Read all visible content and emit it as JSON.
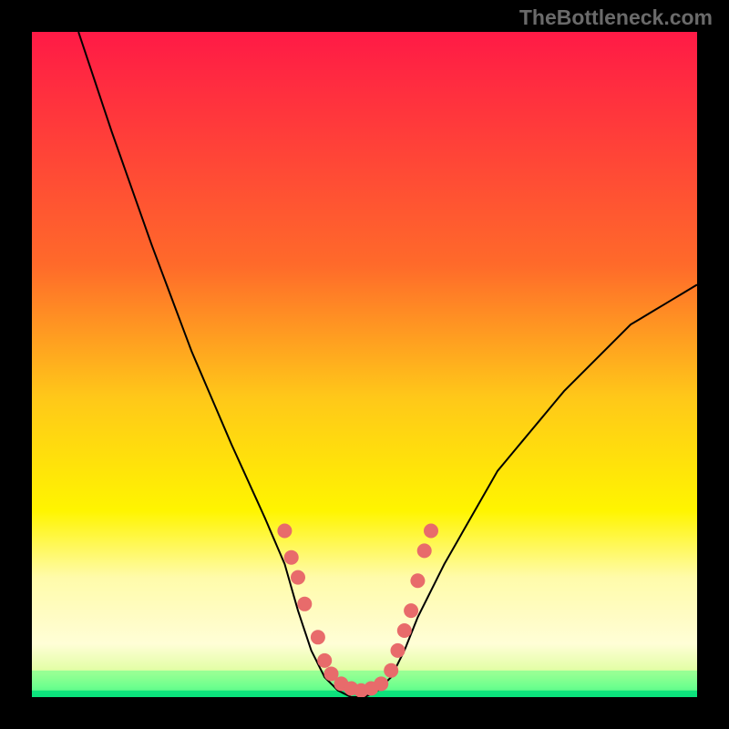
{
  "watermark": "TheBottleneck.com",
  "chart_data": {
    "type": "line",
    "title": "",
    "xlabel": "",
    "ylabel": "",
    "xlim": [
      0,
      100
    ],
    "ylim": [
      0,
      100
    ],
    "background": {
      "type": "vertical-gradient",
      "stops": [
        {
          "offset": 0.0,
          "color": "#ff1a46"
        },
        {
          "offset": 0.35,
          "color": "#ff6a2a"
        },
        {
          "offset": 0.55,
          "color": "#ffc819"
        },
        {
          "offset": 0.72,
          "color": "#fff500"
        },
        {
          "offset": 0.82,
          "color": "#fffbaa"
        },
        {
          "offset": 0.92,
          "color": "#ffffe5"
        },
        {
          "offset": 0.965,
          "color": "#d4ff9a"
        },
        {
          "offset": 0.985,
          "color": "#5aff8a"
        },
        {
          "offset": 1.0,
          "color": "#00e07a"
        }
      ]
    },
    "band_fills": [
      {
        "y_top_pct": 82.0,
        "y_bottom_pct": 100.0,
        "color": "#fffbaa",
        "opacity": 0.25
      },
      {
        "y_top_pct": 96.0,
        "y_bottom_pct": 99.0,
        "color": "#5aff8a",
        "opacity": 0.55
      },
      {
        "y_top_pct": 99.0,
        "y_bottom_pct": 100.0,
        "color": "#00e07a",
        "opacity": 0.85
      }
    ],
    "series": [
      {
        "name": "bottleneck-curve",
        "color": "#000000",
        "points": [
          {
            "x_pct": 7.0,
            "y_pct": 100.0
          },
          {
            "x_pct": 12.0,
            "y_pct": 85.0
          },
          {
            "x_pct": 18.0,
            "y_pct": 68.0
          },
          {
            "x_pct": 24.0,
            "y_pct": 52.0
          },
          {
            "x_pct": 30.0,
            "y_pct": 38.0
          },
          {
            "x_pct": 35.0,
            "y_pct": 27.0
          },
          {
            "x_pct": 38.0,
            "y_pct": 20.0
          },
          {
            "x_pct": 40.0,
            "y_pct": 13.0
          },
          {
            "x_pct": 42.0,
            "y_pct": 7.0
          },
          {
            "x_pct": 44.0,
            "y_pct": 3.0
          },
          {
            "x_pct": 46.0,
            "y_pct": 1.0
          },
          {
            "x_pct": 48.0,
            "y_pct": 0.0
          },
          {
            "x_pct": 50.0,
            "y_pct": 0.0
          },
          {
            "x_pct": 52.0,
            "y_pct": 1.0
          },
          {
            "x_pct": 54.0,
            "y_pct": 3.0
          },
          {
            "x_pct": 56.0,
            "y_pct": 7.0
          },
          {
            "x_pct": 58.0,
            "y_pct": 12.0
          },
          {
            "x_pct": 62.0,
            "y_pct": 20.0
          },
          {
            "x_pct": 70.0,
            "y_pct": 34.0
          },
          {
            "x_pct": 80.0,
            "y_pct": 46.0
          },
          {
            "x_pct": 90.0,
            "y_pct": 56.0
          },
          {
            "x_pct": 100.0,
            "y_pct": 62.0
          }
        ]
      }
    ],
    "markers": {
      "color": "#e86b6b",
      "radius": 8,
      "points": [
        {
          "x_pct": 38.0,
          "y_pct": 25.0
        },
        {
          "x_pct": 39.0,
          "y_pct": 21.0
        },
        {
          "x_pct": 40.0,
          "y_pct": 18.0
        },
        {
          "x_pct": 41.0,
          "y_pct": 14.0
        },
        {
          "x_pct": 43.0,
          "y_pct": 9.0
        },
        {
          "x_pct": 44.0,
          "y_pct": 5.5
        },
        {
          "x_pct": 45.0,
          "y_pct": 3.5
        },
        {
          "x_pct": 46.5,
          "y_pct": 2.0
        },
        {
          "x_pct": 48.0,
          "y_pct": 1.3
        },
        {
          "x_pct": 49.5,
          "y_pct": 1.0
        },
        {
          "x_pct": 51.0,
          "y_pct": 1.3
        },
        {
          "x_pct": 52.5,
          "y_pct": 2.0
        },
        {
          "x_pct": 54.0,
          "y_pct": 4.0
        },
        {
          "x_pct": 55.0,
          "y_pct": 7.0
        },
        {
          "x_pct": 56.0,
          "y_pct": 10.0
        },
        {
          "x_pct": 57.0,
          "y_pct": 13.0
        },
        {
          "x_pct": 58.0,
          "y_pct": 17.5
        },
        {
          "x_pct": 59.0,
          "y_pct": 22.0
        },
        {
          "x_pct": 60.0,
          "y_pct": 25.0
        }
      ]
    }
  }
}
